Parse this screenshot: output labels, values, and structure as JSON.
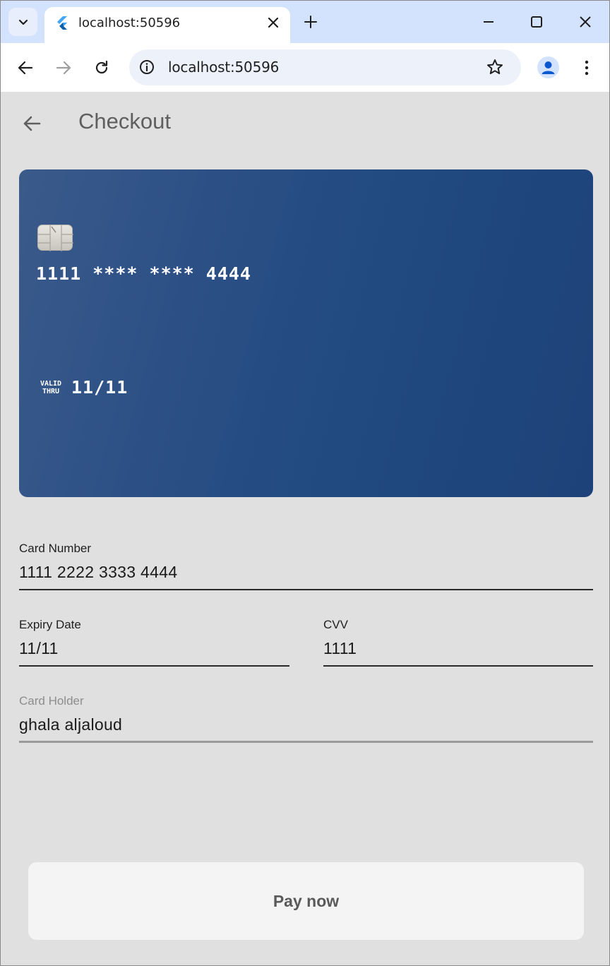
{
  "browser": {
    "tab_title": "localhost:50596",
    "url": "localhost:50596"
  },
  "app": {
    "title": "Checkout",
    "card_preview": {
      "number": "1111 **** **** 4444",
      "valid_thru_label_line1": "VALID",
      "valid_thru_label_line2": "THRU",
      "expiry": "11/11"
    },
    "form": {
      "card_number": {
        "label": "Card Number",
        "value": "1111 2222 3333 4444"
      },
      "expiry_date": {
        "label": "Expiry Date",
        "value": "11/11"
      },
      "cvv": {
        "label": "CVV",
        "value": "1111"
      },
      "card_holder": {
        "label": "Card Holder",
        "value": "ghala aljaloud"
      }
    },
    "pay_button": "Pay now"
  },
  "colors": {
    "tabstrip": "#d3e3fd",
    "background": "#e0e0e0",
    "card": "#2c5086",
    "button": "#f4f4f4"
  }
}
